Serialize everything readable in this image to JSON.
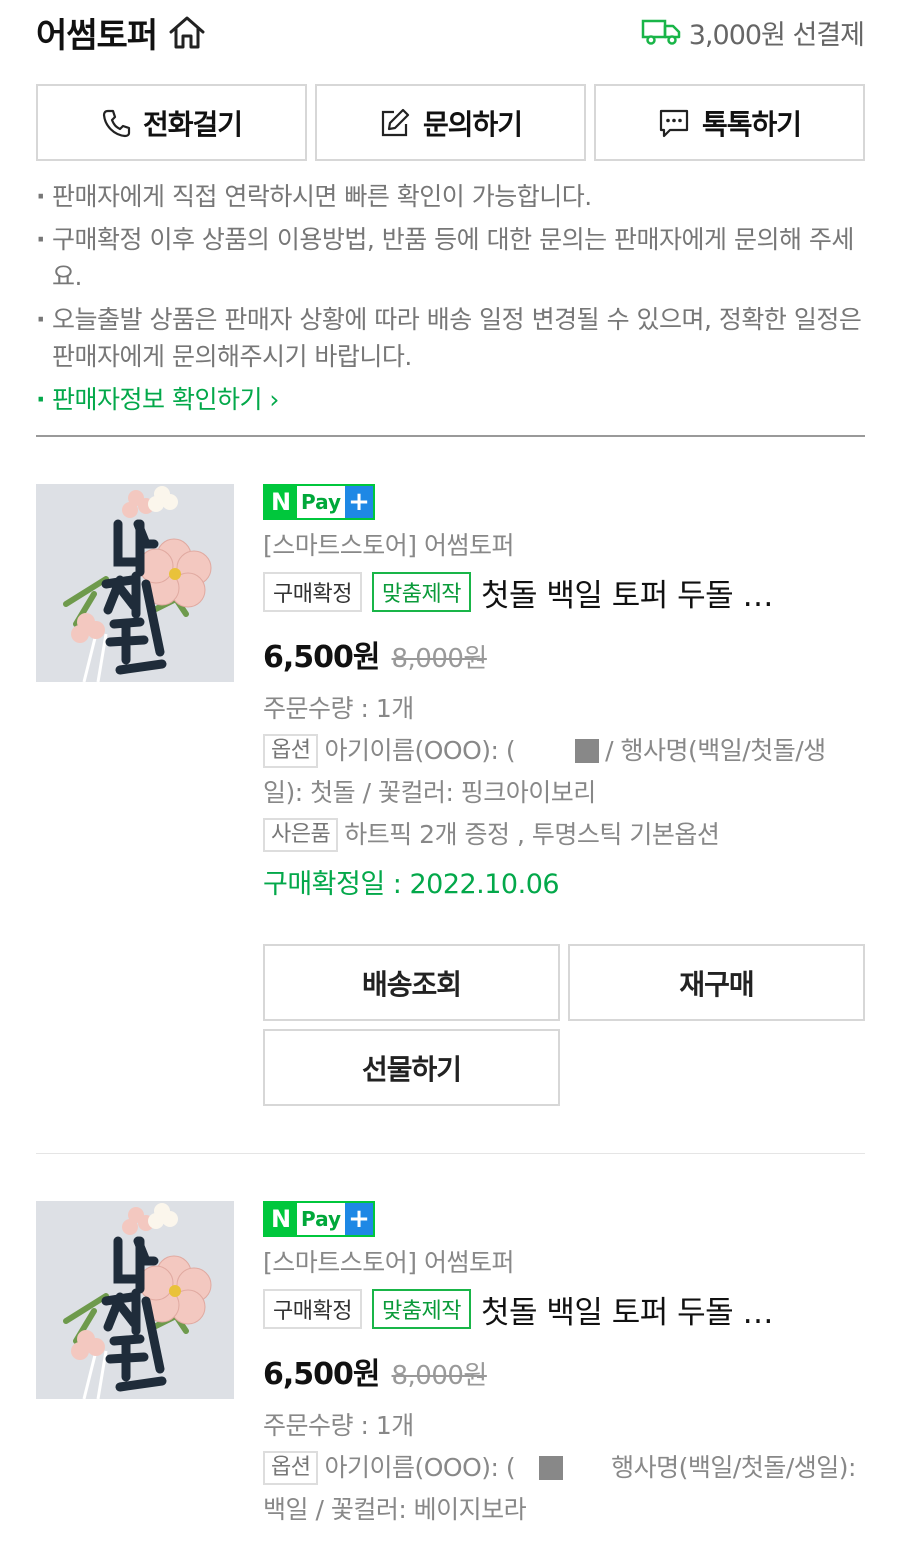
{
  "header": {
    "store_name": "어썸토퍼",
    "shipping_text": "3,000원 선결제"
  },
  "contact": {
    "call_label": "전화걸기",
    "inquiry_label": "문의하기",
    "talk_label": "톡톡하기"
  },
  "notices": [
    "판매자에게 직접 연락하시면 빠른 확인이 가능합니다.",
    "구매확정 이후 상품의 이용방법, 반품 등에 대한 문의는 판매자에게 문의해 주세요.",
    "오늘출발 상품은 판매자 상황에 따라 배송 일정 변경될 수 있으며, 정확한 일정은 판매자에게 문의해주시기 바랍니다."
  ],
  "seller_info_link": "판매자정보 확인하기",
  "orders": [
    {
      "pay_badge": {
        "n": "N",
        "pay": "Pay",
        "plus": "+"
      },
      "seller": "[스마트스토어] 어썸토퍼",
      "status_tag": "구매확정",
      "custom_tag": "맞춤제작",
      "title": "첫돌 백일 토퍼 두돌 …",
      "price": "6,500원",
      "original_price": "8,000원",
      "quantity": "주문수량 : 1개",
      "option_label": "옵션",
      "option_text_1": "아기이름(OOO): (",
      "option_text_2": "/ 행사명(백일/첫돌/생일): 첫돌 / 꽃컬러: 핑크아이보리",
      "gift_label": "사은품",
      "gift_text": "하트픽 2개 증정 , 투명스틱 기본옵션",
      "confirm_date": "구매확정일 : 2022.10.06",
      "actions": [
        "배송조회",
        "재구매",
        "선물하기"
      ]
    },
    {
      "pay_badge": {
        "n": "N",
        "pay": "Pay",
        "plus": "+"
      },
      "seller": "[스마트스토어] 어썸토퍼",
      "status_tag": "구매확정",
      "custom_tag": "맞춤제작",
      "title": "첫돌 백일 토퍼 두돌 …",
      "price": "6,500원",
      "original_price": "8,000원",
      "quantity": "주문수량 : 1개",
      "option_label": "옵션",
      "option_text_1": "아기이름(OOO): (",
      "option_text_2": "행사명(백일/첫돌/생일): 백일 / 꽃컬러: 베이지보라"
    }
  ]
}
